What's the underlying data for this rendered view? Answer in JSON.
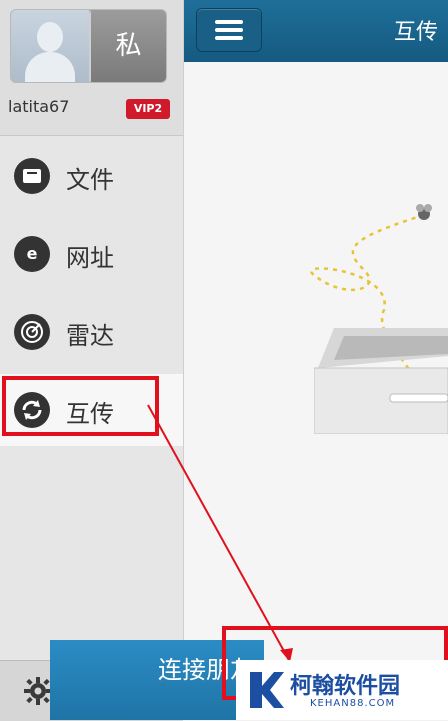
{
  "sidebar": {
    "profile": {
      "private_label": "私",
      "username": "latita67",
      "vip_badge": "VIP2"
    },
    "items": [
      {
        "label": "文件",
        "icon": "file-icon"
      },
      {
        "label": "网址",
        "icon": "e-browser-icon"
      },
      {
        "label": "雷达",
        "icon": "radar-icon"
      },
      {
        "label": "互传",
        "icon": "transfer-icon",
        "active": true
      }
    ],
    "settings_icon": "gear-icon"
  },
  "header": {
    "title": "互传",
    "menu_icon": "hamburger-icon"
  },
  "main": {
    "connect_label": "连接朋友"
  },
  "watermark": {
    "title": "柯翰软件园",
    "url": "KEHAN88.COM"
  },
  "colors": {
    "accent_blue": "#1e6f9a",
    "highlight_red": "#e0101d",
    "vip_red": "#d0192a"
  }
}
